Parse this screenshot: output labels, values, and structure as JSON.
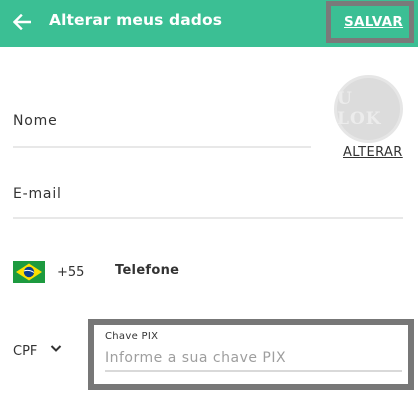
{
  "header": {
    "title": "Alterar meus dados",
    "save_label": "SALVAR",
    "back_icon": "arrow-left-icon",
    "background_color": "#3bbf94"
  },
  "form": {
    "name_label": "Nome",
    "email_label": "E-mail",
    "phone": {
      "flag_icon": "brazil-flag-icon",
      "dial_code": "+55",
      "label": "Telefone"
    },
    "document": {
      "selected": "CPF",
      "chevron_icon": "chevron-down-icon"
    },
    "pix": {
      "label": "Chave PIX",
      "placeholder": "Informe a sua chave PIX",
      "value": ""
    }
  },
  "avatar": {
    "text": "U LOK",
    "change_label": "ALTERAR"
  }
}
